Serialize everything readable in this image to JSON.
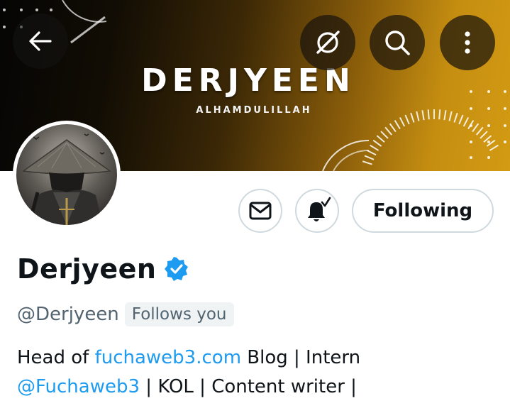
{
  "banner": {
    "title": "DERJYEEN",
    "subtitle": "ALHAMDULILLAH",
    "back_icon": "arrow-left-icon",
    "grok_icon": "grok-slash-icon",
    "search_icon": "search-icon",
    "more_icon": "more-vertical-icon"
  },
  "avatar": {
    "description_icon": "avatar-warrior-image"
  },
  "actions": {
    "message_icon": "envelope-icon",
    "notification_icon": "bell-check-icon",
    "follow_label": "Following"
  },
  "profile": {
    "display_name": "Derjyeen",
    "handle": "@Derjyeen",
    "follows_you": "Follows you",
    "bio": {
      "part1": "Head of ",
      "link1": "fuchaweb3.com",
      "part2": " Blog | Intern",
      "link2": "@Fuchaweb3",
      "part3": " | KOL | Content writer |"
    }
  },
  "colors": {
    "accent": "#1d9bf0",
    "text_primary": "#0f1419",
    "text_secondary": "#536471",
    "border": "#cfd9de",
    "banner_gold": "#d39a12"
  }
}
